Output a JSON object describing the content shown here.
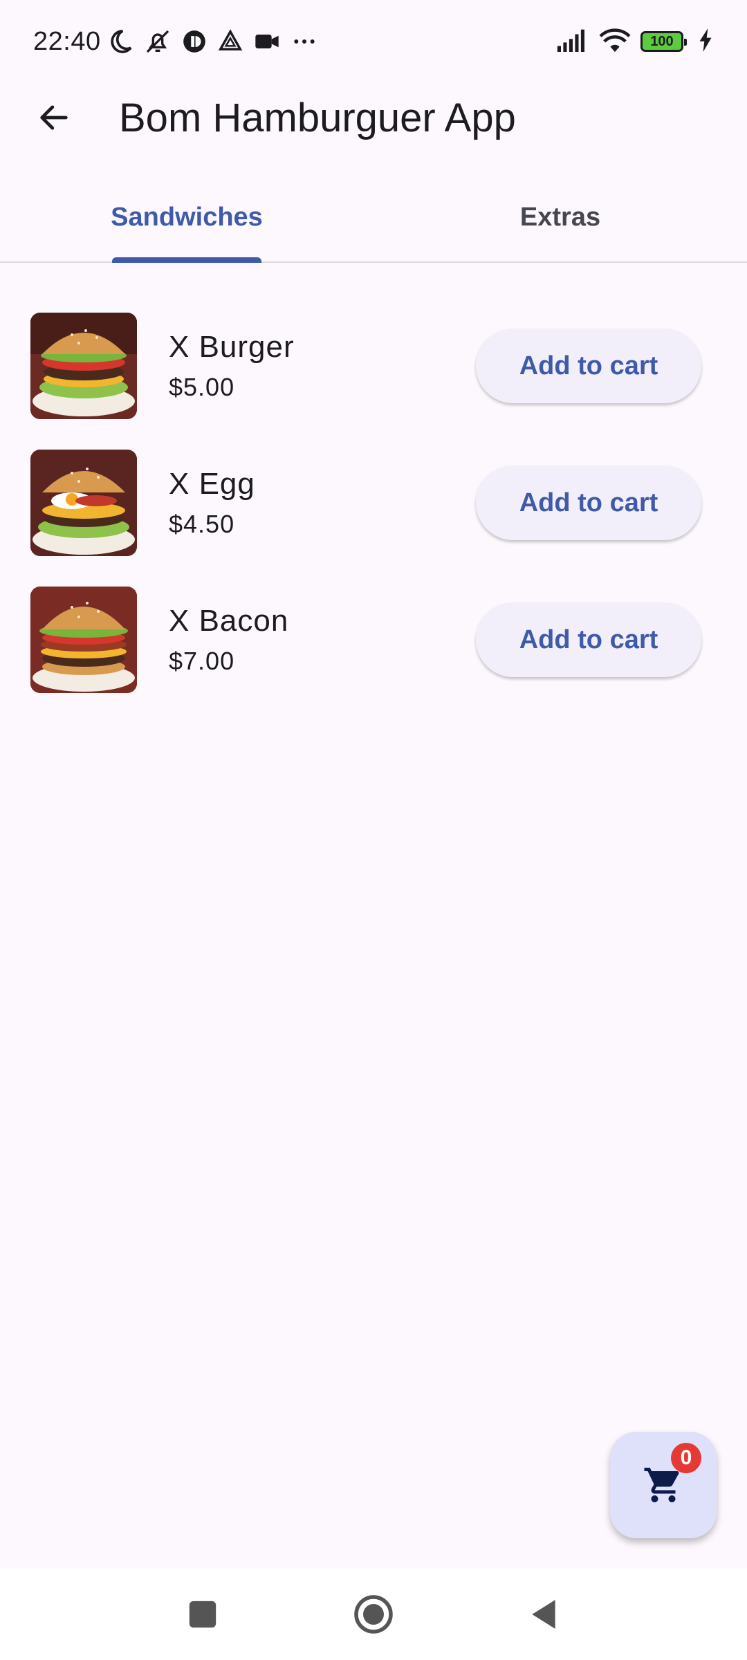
{
  "status_bar": {
    "time": "22:40",
    "battery": "100",
    "icons_left": [
      "moon-icon",
      "bell-off-icon",
      "app-icon",
      "drive-icon",
      "camera-icon",
      "more-dots-icon"
    ],
    "icons_right": [
      "signal-icon",
      "wifi-icon",
      "battery-icon",
      "charging-icon"
    ]
  },
  "app_bar": {
    "title": "Bom Hamburguer App",
    "back_icon": "arrow-back-icon"
  },
  "tabs": [
    {
      "label": "Sandwiches",
      "active": true
    },
    {
      "label": "Extras",
      "active": false
    }
  ],
  "products": [
    {
      "name": "X Burger",
      "price": "$5.00",
      "button": "Add to cart"
    },
    {
      "name": "X Egg",
      "price": "$4.50",
      "button": "Add to cart"
    },
    {
      "name": "X Bacon",
      "price": "$7.00",
      "button": "Add to cart"
    }
  ],
  "cart": {
    "count": "0",
    "icon": "shopping-cart-icon"
  },
  "colors": {
    "accent": "#3f5aa9",
    "background": "#fdf8fd",
    "button_bg": "#f3effa",
    "fab_bg": "#dfe1fb",
    "badge": "#e53935"
  },
  "nav_bar": {
    "icons": [
      "recents-square-icon",
      "home-circle-icon",
      "back-triangle-icon"
    ]
  }
}
